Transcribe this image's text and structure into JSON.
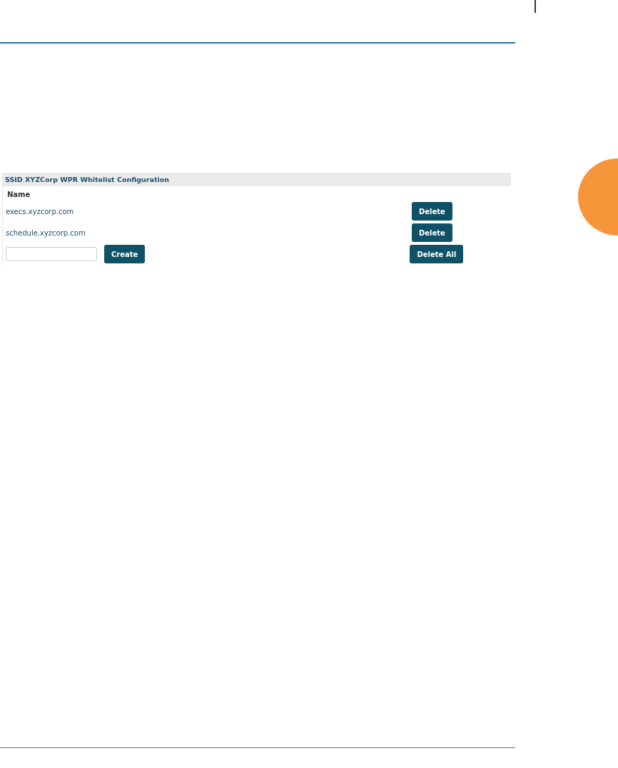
{
  "panel": {
    "title": "SSID XYZCorp   WPR Whitelist Configuration",
    "column": "Name",
    "entries": [
      {
        "name": "execs.xyzcorp.com",
        "button": "Delete"
      },
      {
        "name": "schedule.xyzcorp.com",
        "button": "Delete"
      }
    ],
    "create_button": "Create",
    "delete_all_button": "Delete All"
  }
}
